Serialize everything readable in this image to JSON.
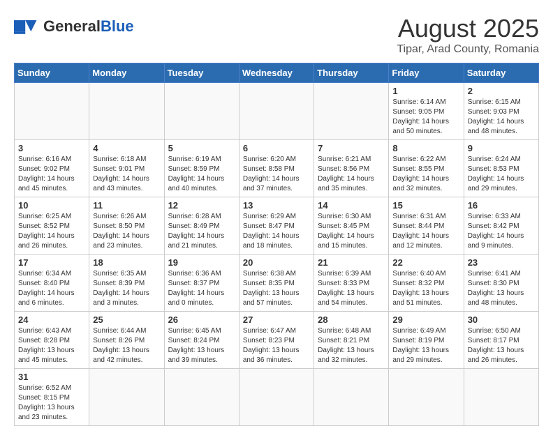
{
  "logo": {
    "text_general": "General",
    "text_blue": "Blue"
  },
  "calendar": {
    "title": "August 2025",
    "subtitle": "Tipar, Arad County, Romania"
  },
  "headers": [
    "Sunday",
    "Monday",
    "Tuesday",
    "Wednesday",
    "Thursday",
    "Friday",
    "Saturday"
  ],
  "days": [
    {
      "date": "",
      "info": ""
    },
    {
      "date": "",
      "info": ""
    },
    {
      "date": "",
      "info": ""
    },
    {
      "date": "",
      "info": ""
    },
    {
      "date": "",
      "info": ""
    },
    {
      "date": "1",
      "info": "Sunrise: 6:14 AM\nSunset: 9:05 PM\nDaylight: 14 hours and 50 minutes."
    },
    {
      "date": "2",
      "info": "Sunrise: 6:15 AM\nSunset: 9:03 PM\nDaylight: 14 hours and 48 minutes."
    },
    {
      "date": "3",
      "info": "Sunrise: 6:16 AM\nSunset: 9:02 PM\nDaylight: 14 hours and 45 minutes."
    },
    {
      "date": "4",
      "info": "Sunrise: 6:18 AM\nSunset: 9:01 PM\nDaylight: 14 hours and 43 minutes."
    },
    {
      "date": "5",
      "info": "Sunrise: 6:19 AM\nSunset: 8:59 PM\nDaylight: 14 hours and 40 minutes."
    },
    {
      "date": "6",
      "info": "Sunrise: 6:20 AM\nSunset: 8:58 PM\nDaylight: 14 hours and 37 minutes."
    },
    {
      "date": "7",
      "info": "Sunrise: 6:21 AM\nSunset: 8:56 PM\nDaylight: 14 hours and 35 minutes."
    },
    {
      "date": "8",
      "info": "Sunrise: 6:22 AM\nSunset: 8:55 PM\nDaylight: 14 hours and 32 minutes."
    },
    {
      "date": "9",
      "info": "Sunrise: 6:24 AM\nSunset: 8:53 PM\nDaylight: 14 hours and 29 minutes."
    },
    {
      "date": "10",
      "info": "Sunrise: 6:25 AM\nSunset: 8:52 PM\nDaylight: 14 hours and 26 minutes."
    },
    {
      "date": "11",
      "info": "Sunrise: 6:26 AM\nSunset: 8:50 PM\nDaylight: 14 hours and 23 minutes."
    },
    {
      "date": "12",
      "info": "Sunrise: 6:28 AM\nSunset: 8:49 PM\nDaylight: 14 hours and 21 minutes."
    },
    {
      "date": "13",
      "info": "Sunrise: 6:29 AM\nSunset: 8:47 PM\nDaylight: 14 hours and 18 minutes."
    },
    {
      "date": "14",
      "info": "Sunrise: 6:30 AM\nSunset: 8:45 PM\nDaylight: 14 hours and 15 minutes."
    },
    {
      "date": "15",
      "info": "Sunrise: 6:31 AM\nSunset: 8:44 PM\nDaylight: 14 hours and 12 minutes."
    },
    {
      "date": "16",
      "info": "Sunrise: 6:33 AM\nSunset: 8:42 PM\nDaylight: 14 hours and 9 minutes."
    },
    {
      "date": "17",
      "info": "Sunrise: 6:34 AM\nSunset: 8:40 PM\nDaylight: 14 hours and 6 minutes."
    },
    {
      "date": "18",
      "info": "Sunrise: 6:35 AM\nSunset: 8:39 PM\nDaylight: 14 hours and 3 minutes."
    },
    {
      "date": "19",
      "info": "Sunrise: 6:36 AM\nSunset: 8:37 PM\nDaylight: 14 hours and 0 minutes."
    },
    {
      "date": "20",
      "info": "Sunrise: 6:38 AM\nSunset: 8:35 PM\nDaylight: 13 hours and 57 minutes."
    },
    {
      "date": "21",
      "info": "Sunrise: 6:39 AM\nSunset: 8:33 PM\nDaylight: 13 hours and 54 minutes."
    },
    {
      "date": "22",
      "info": "Sunrise: 6:40 AM\nSunset: 8:32 PM\nDaylight: 13 hours and 51 minutes."
    },
    {
      "date": "23",
      "info": "Sunrise: 6:41 AM\nSunset: 8:30 PM\nDaylight: 13 hours and 48 minutes."
    },
    {
      "date": "24",
      "info": "Sunrise: 6:43 AM\nSunset: 8:28 PM\nDaylight: 13 hours and 45 minutes."
    },
    {
      "date": "25",
      "info": "Sunrise: 6:44 AM\nSunset: 8:26 PM\nDaylight: 13 hours and 42 minutes."
    },
    {
      "date": "26",
      "info": "Sunrise: 6:45 AM\nSunset: 8:24 PM\nDaylight: 13 hours and 39 minutes."
    },
    {
      "date": "27",
      "info": "Sunrise: 6:47 AM\nSunset: 8:23 PM\nDaylight: 13 hours and 36 minutes."
    },
    {
      "date": "28",
      "info": "Sunrise: 6:48 AM\nSunset: 8:21 PM\nDaylight: 13 hours and 32 minutes."
    },
    {
      "date": "29",
      "info": "Sunrise: 6:49 AM\nSunset: 8:19 PM\nDaylight: 13 hours and 29 minutes."
    },
    {
      "date": "30",
      "info": "Sunrise: 6:50 AM\nSunset: 8:17 PM\nDaylight: 13 hours and 26 minutes."
    },
    {
      "date": "31",
      "info": "Sunrise: 6:52 AM\nSunset: 8:15 PM\nDaylight: 13 hours and 23 minutes."
    }
  ]
}
